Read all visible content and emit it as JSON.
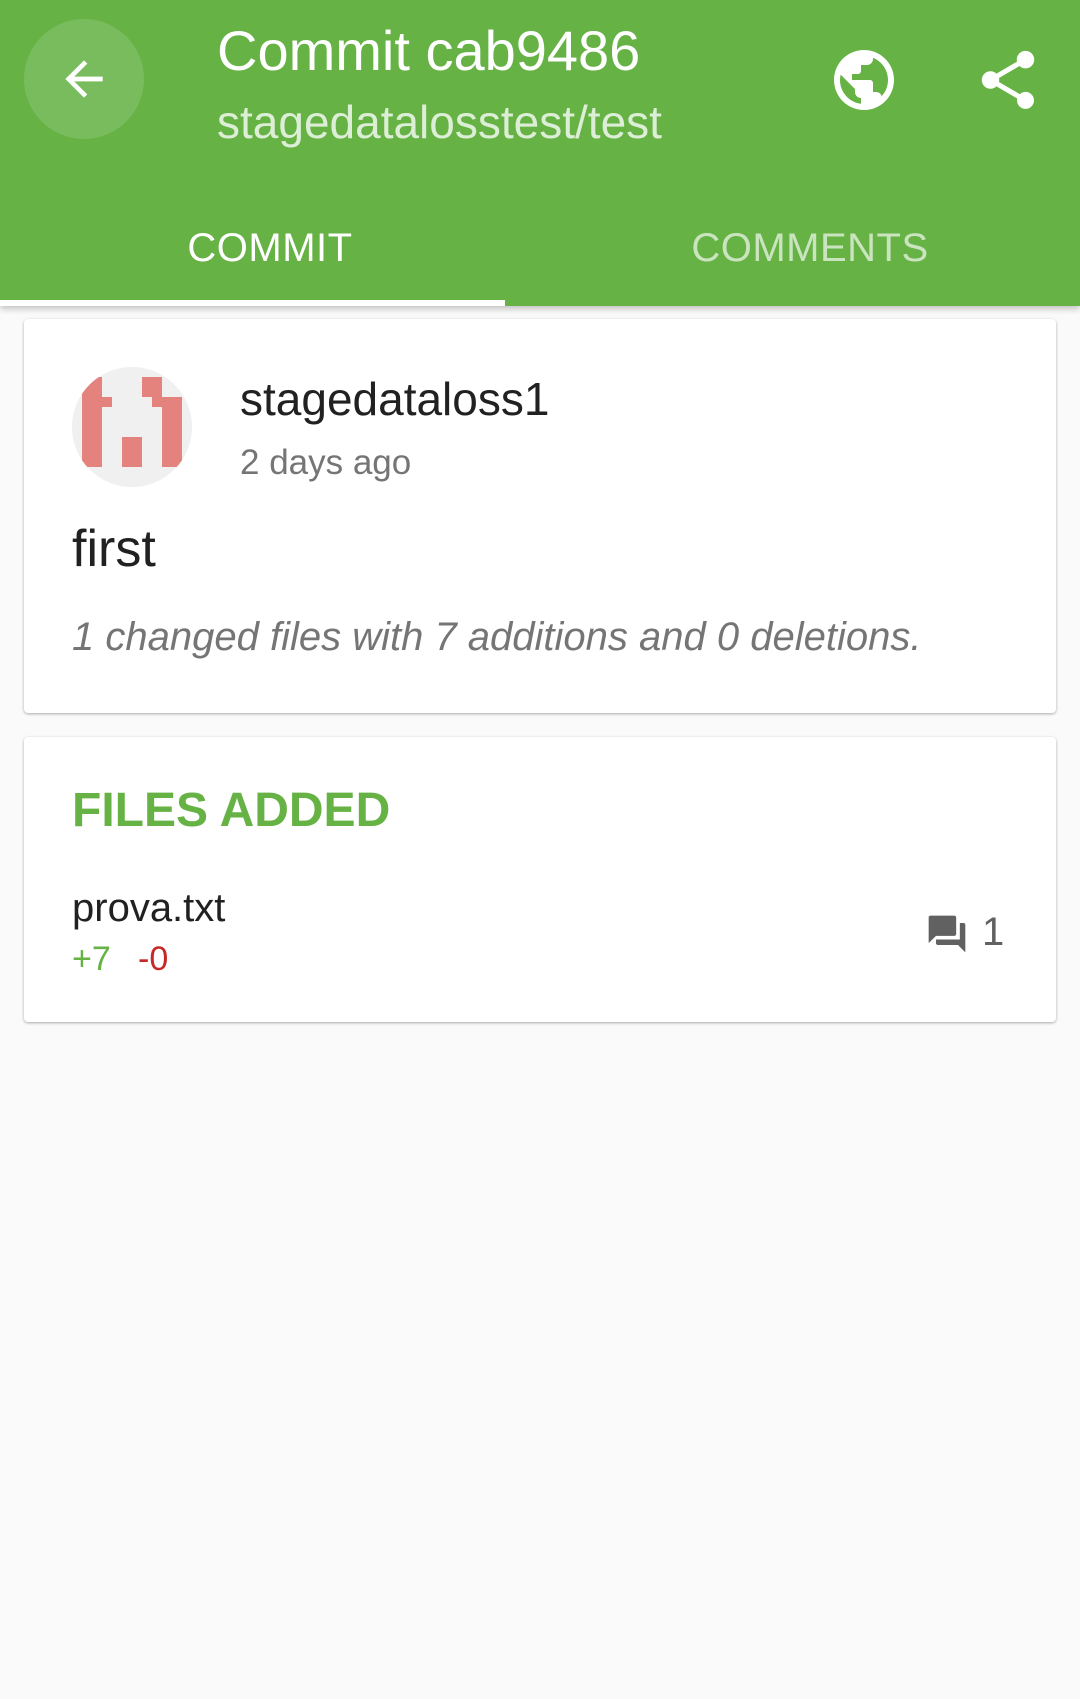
{
  "header": {
    "title": "Commit cab9486",
    "subtitle": "stagedatalosstest/test",
    "icons": {
      "back": "arrow-back-icon",
      "browser": "globe-icon",
      "share": "share-icon"
    },
    "colors": {
      "primary": "#66b245",
      "on_primary": "#ffffff"
    }
  },
  "tabs": [
    {
      "label": "COMMIT",
      "active": true
    },
    {
      "label": "COMMENTS",
      "active": false
    }
  ],
  "commit": {
    "author": "stagedataloss1",
    "date": "2 days ago",
    "message": "first",
    "summary": "1 changed files with 7 additions and 0 deletions.",
    "avatar": "identicon-avatar"
  },
  "files_section": {
    "title": "FILES ADDED",
    "files": [
      {
        "name": "prova.txt",
        "additions": "+7",
        "deletions": "-0",
        "comment_count": "1",
        "comment_icon": "comment-icon"
      }
    ],
    "colors": {
      "additions": "#66b245",
      "deletions": "#c62828"
    }
  }
}
